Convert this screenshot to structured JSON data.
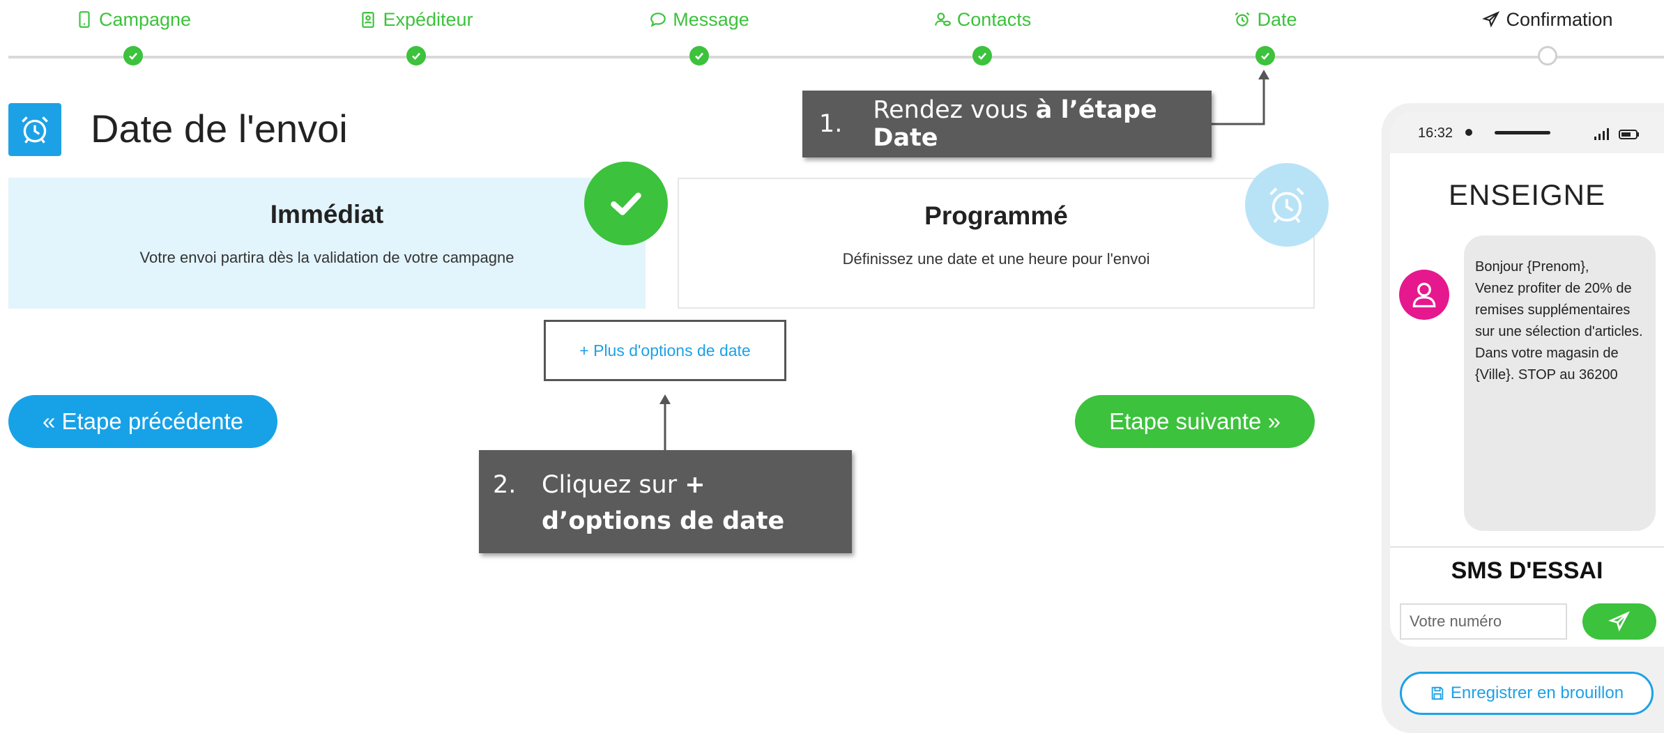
{
  "stepper": {
    "steps": [
      {
        "label": "Campagne",
        "icon": "mobile-icon",
        "state": "done"
      },
      {
        "label": "Expéditeur",
        "icon": "badge-icon",
        "state": "done"
      },
      {
        "label": "Message",
        "icon": "chat-bubble-icon",
        "state": "done"
      },
      {
        "label": "Contacts",
        "icon": "contacts-icon",
        "state": "done"
      },
      {
        "label": "Date",
        "icon": "alarm-clock-icon",
        "state": "done"
      },
      {
        "label": "Confirmation",
        "icon": "paper-plane-icon",
        "state": "current"
      }
    ],
    "done_color": "#3cc23c"
  },
  "page": {
    "title": "Date de l'envoi",
    "title_icon": "alarm-clock-icon"
  },
  "options": {
    "immediate": {
      "title": "Immédiat",
      "description": "Votre envoi partira dès la validation de votre campagne",
      "selected": true
    },
    "scheduled": {
      "title": "Programmé",
      "description": "Définissez une date et une heure pour l'envoi",
      "selected": false
    },
    "more_options_label": "+ Plus d'options de date"
  },
  "nav": {
    "prev_label": "« Etape précédente",
    "next_label": "Etape suivante »"
  },
  "callouts": {
    "one": {
      "number": "1.",
      "text": "Rendez vous ",
      "bold": "à l’étape Date"
    },
    "two": {
      "number": "2.",
      "text": "Cliquez sur ",
      "bold": "+ d’options de date"
    }
  },
  "preview": {
    "time": "16:32",
    "sender": "ENSEIGNE",
    "message": "Bonjour {Prenom},\nVenez profiter de 20% de remises supplémentaires sur une sélection d'articles. Dans votre magasin de {Ville}. STOP au 36200",
    "test_title": "SMS D'ESSAI",
    "test_placeholder": "Votre numéro",
    "draft_label": "Enregistrer en brouillon"
  },
  "colors": {
    "blue": "#1da1e6",
    "green": "#3cc23c",
    "pink": "#e6188e",
    "callout": "#5b5b5b"
  }
}
